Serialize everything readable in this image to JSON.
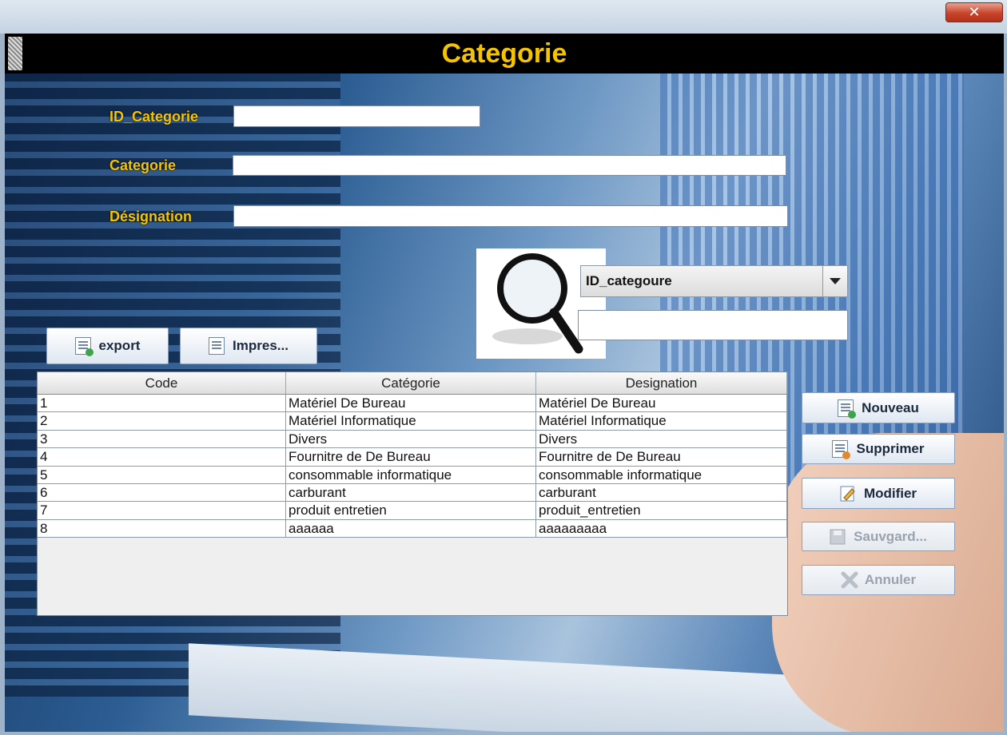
{
  "window": {
    "close_glyph": "✕"
  },
  "header": {
    "title": "Categorie"
  },
  "form": {
    "id_label": "ID_Categorie",
    "id_value": "",
    "categorie_label": "Categorie",
    "categorie_value": "",
    "designation_label": "Désignation",
    "designation_value": ""
  },
  "search": {
    "icon": "magnifier-icon",
    "field_selected": "ID_categoure",
    "query": ""
  },
  "toolbar": {
    "export_label": "export",
    "print_label": "Impres..."
  },
  "table": {
    "columns": [
      "Code",
      "Catégorie",
      "Designation"
    ],
    "rows": [
      [
        "1",
        "Matériel De Bureau",
        "Matériel De Bureau"
      ],
      [
        "2",
        "Matériel Informatique",
        "Matériel Informatique"
      ],
      [
        "3",
        "Divers",
        "Divers"
      ],
      [
        "4",
        "Fournitre de  De Bureau",
        "Fournitre de  De Bureau"
      ],
      [
        "5",
        "consommable informatique",
        "consommable informatique"
      ],
      [
        "6",
        "carburant",
        "carburant"
      ],
      [
        "7",
        "produit entretien",
        "produit_entretien"
      ],
      [
        "8",
        "aaaaaa",
        "aaaaaaaaa"
      ]
    ]
  },
  "actions": {
    "nouveau": "Nouveau",
    "supprimer": "Supprimer",
    "modifier": "Modifier",
    "sauvgarder": "Sauvgard...",
    "annuler": "Annuler"
  },
  "colors": {
    "title": "#f5c400",
    "header_bg": "#000000"
  }
}
